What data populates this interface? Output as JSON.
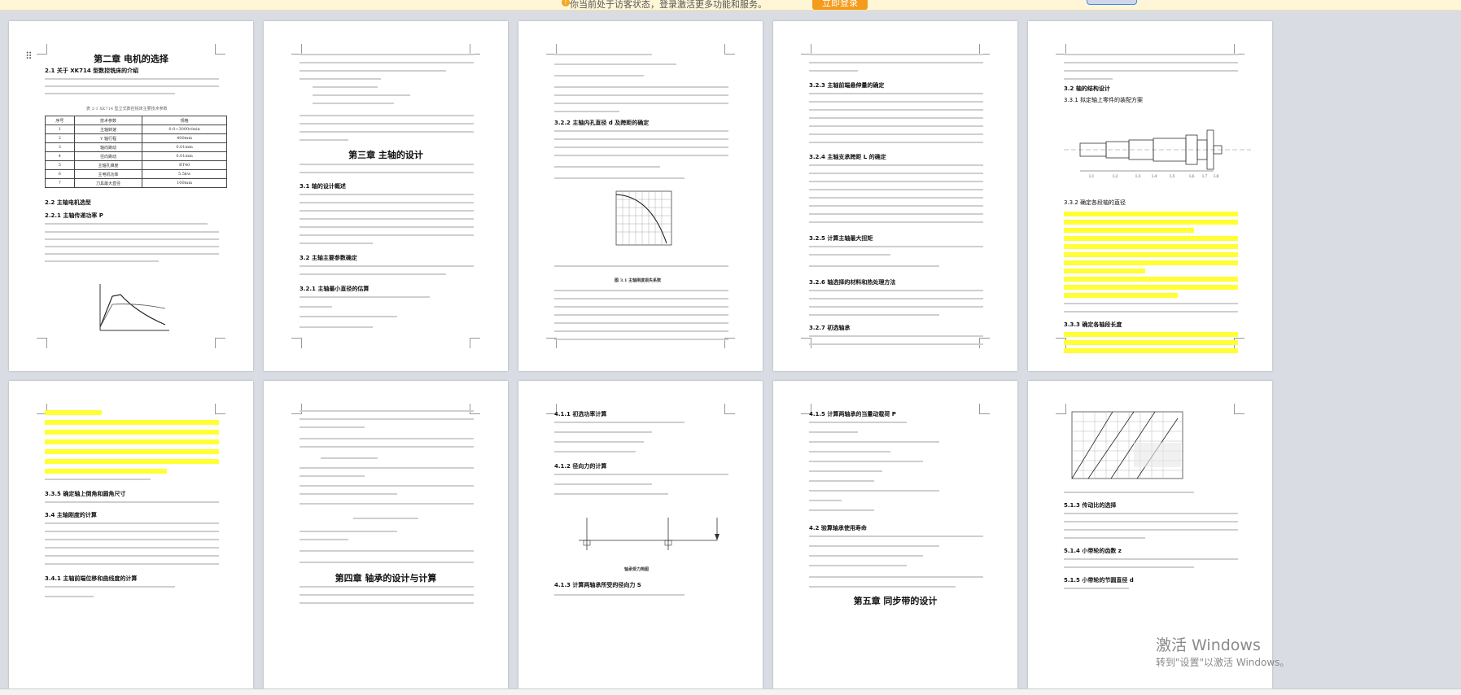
{
  "banner": {
    "text": "你当前处于访客状态，登录激活更多功能和服务。",
    "login_label": "立即登录"
  },
  "pages": {
    "p1": {
      "chapter_title": "第二章  电机的选择",
      "s21": "2.1 关于 XK714 型数控铣床的介绍",
      "table_caption": "表 2-1 XK714 型立式数控铣床主要技术参数",
      "table_head": [
        "序号",
        "技术参数",
        "规格"
      ],
      "table_rows": [
        [
          "1",
          "主轴转速",
          "0.0~3000r/min"
        ],
        [
          "2",
          "Y 轴行程",
          "400mm"
        ],
        [
          "3",
          "轴向跳动",
          "0.01mm"
        ],
        [
          "4",
          "径向跳动",
          "0.01mm"
        ],
        [
          "5",
          "主轴孔锥度",
          "BT40"
        ],
        [
          "6",
          "主电机功率",
          "5.5kw"
        ],
        [
          "7",
          "刀具最大直径",
          "100mm"
        ]
      ],
      "s22": "2.2 主轴电机选型",
      "s221": "2.2.1 主轴传递功率 P"
    },
    "p2": {
      "chapter_title": "第三章  主轴的设计",
      "s31": "3.1 轴的设计概述",
      "s32": "3.2 主轴主要参数确定",
      "s321": "3.2.1 主轴最小直径的估算"
    },
    "p3": {
      "s322": "3.2.2 主轴内孔直径 d 及跨距的确定",
      "chart_caption": "图 3.1 主轴刚度损失系数"
    },
    "p4": {
      "s323": "3.2.3 主轴前端悬伸量的确定",
      "s324": "3.2.4 主轴支承跨距 L 的确定",
      "s325": "3.2.5 计算主轴最大扭矩",
      "s326": "3.2.6 轴选择的材料和热处理方法",
      "s327": "3.2.7 初选轴承"
    },
    "p5": {
      "s32a": "3.2 轴的结构设计",
      "s331": "3.3.1 拟定轴上零件的装配方案",
      "s332": "3.3.2 确定各段轴的直径",
      "s333": "3.3.3 确定各轴段长度",
      "shaft_labels": [
        "L1",
        "L2",
        "L3",
        "L4",
        "L5",
        "L6",
        "L7",
        "L8"
      ]
    },
    "p6": {
      "s335": "3.3.5 确定轴上倒角和圆角尺寸",
      "s34": "3.4 主轴刚度的计算",
      "s341": "3.4.1 主轴前端位移和曲线度的计算"
    },
    "p7": {
      "chapter_title": "第四章  轴承的设计与计算"
    },
    "p8": {
      "s411": "4.1.1 初选功率计算",
      "s412": "4.1.2 径向力的计算",
      "s413": "4.1.3 计算两轴承所受的径向力 S",
      "fig_caption": "轴承受力简图"
    },
    "p9": {
      "s415": "4.1.5 计算两轴承的当量动载荷 P",
      "s42": "4.2 验算轴承使用寿命",
      "chapter_title": "第五章  同步带的设计"
    },
    "p10": {
      "s513": "5.1.3 传动比的选择",
      "s514": "5.1.4 小带轮的齿数 z",
      "s515": "5.1.5 小带轮的节圆直径 d"
    }
  },
  "watermark": {
    "line1": "激活 Windows",
    "line2": "转到\"设置\"以激活 Windows。"
  },
  "colors": {
    "page": "#ffffff",
    "canvas": "#d9dde3",
    "highlight": "#ffff33",
    "login": "#f59b1b"
  }
}
